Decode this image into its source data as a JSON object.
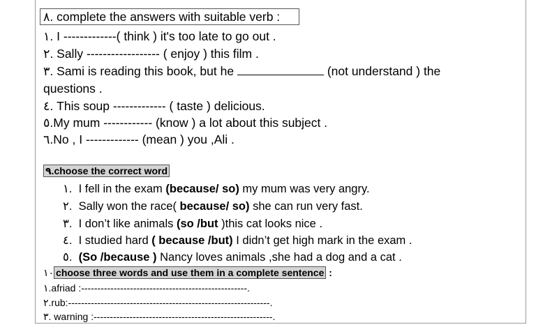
{
  "sec8": {
    "num": "٨.",
    "title": " complete the answers with suitable verb :",
    "items": [
      {
        "num": "١.",
        "pre": "I -------------",
        "hint": "( think )",
        "post": " it's too late to go out ."
      },
      {
        "num": "٢.",
        "pre": "Sally  ------------------",
        "hint": " ( enjoy )",
        "post": " this film ."
      },
      {
        "num": "٣.",
        "pre": "Sami is reading this book, but he",
        "hint": "(not understand ) the",
        "post": ""
      },
      {
        "num": "",
        "pre": "questions  .",
        "hint": "",
        "post": ""
      },
      {
        "num": "٤.",
        "pre": "This  soup -------------",
        "hint": " ( taste )",
        "post": " delicious."
      },
      {
        "num": "٥.",
        "pre": "My mum ------------",
        "hint": " (know )",
        "post": " a lot  about this subject ."
      },
      {
        "num": "٦.",
        "pre": "No , I -------------",
        "hint": " (mean )",
        "post": " you ,Ali ."
      }
    ]
  },
  "sec9": {
    "num": "٩.",
    "title": "choose the correct word",
    "items": [
      {
        "num": "١.",
        "pre": "I fell  in the exam ",
        "choice": "(because/ so)",
        "post": " my mum was very angry."
      },
      {
        "num": "٢.",
        "pre": "Sally won the race( ",
        "choice": "because/ so)",
        "post": "  she can run very fast."
      },
      {
        "num": "٣.",
        "pre": "I don’t like animals ",
        "choice": "(so /but",
        "post": " )this cat looks nice ."
      },
      {
        "num": "٤.",
        "pre": "I studied hard ",
        "choice": "( because /but)",
        "post": "  I didn’t get high mark in the exam ."
      },
      {
        "num": "٥.",
        "pre": "",
        "choice": "(So /because )",
        "post": " Nancy loves animals ,she had a dog and a cat ."
      }
    ]
  },
  "sec10": {
    "num": "١٠",
    "title": "choose three words and use them in a complete sentence",
    "colon": " :",
    "items": [
      {
        "num": "١",
        "text": ".afriad :---------------------------------------------------."
      },
      {
        "num": "٢",
        "text": ".rub:--------------------------------------------------------------."
      },
      {
        "num": "٣",
        "text": ". warning :-------------------------------------------------------."
      }
    ]
  }
}
